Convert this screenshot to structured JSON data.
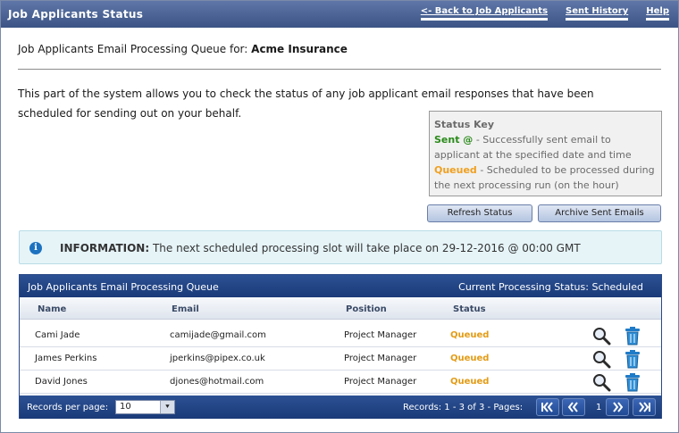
{
  "window": {
    "title": "Job Applicants Status",
    "links": [
      "<- Back to Job Applicants",
      "Sent History",
      "Help"
    ]
  },
  "header": {
    "prefix": "Job Applicants Email Processing Queue for:",
    "company": "Acme Insurance"
  },
  "description": "This part of the system allows you to check the status of any job applicant email responses that have been scheduled for sending out on your behalf.",
  "status_key": {
    "title": "Status Key",
    "sent_label": "Sent @",
    "sent_text": "- Successfully sent email to applicant at the specified date and time",
    "queued_label": "Queued",
    "queued_text": "- Scheduled to be processed during the next processing run (on the hour)"
  },
  "buttons": {
    "refresh": "Refresh Status",
    "archive": "Archive Sent Emails"
  },
  "info": {
    "label": "INFORMATION:",
    "text": "The next scheduled processing slot will take place on 29-12-2016 @ 00:00 GMT"
  },
  "grid": {
    "title": "Job Applicants Email Processing Queue",
    "processing_status": "Current Processing Status: Scheduled",
    "columns": [
      "Name",
      "Email",
      "Position",
      "Status"
    ],
    "rows": [
      {
        "name": "Cami Jade",
        "email": "camijade@gmail.com",
        "position": "Project Manager",
        "status": "Queued"
      },
      {
        "name": "James Perkins",
        "email": "jperkins@pipex.co.uk",
        "position": "Project Manager",
        "status": "Queued"
      },
      {
        "name": "David Jones",
        "email": "djones@hotmail.com",
        "position": "Project Manager",
        "status": "Queued"
      }
    ],
    "footer": {
      "records_per_page_label": "Records per page:",
      "records_per_page_value": "10",
      "records_text": "Records: 1 - 3 of 3 - Pages:",
      "current_page": "1"
    }
  },
  "colors": {
    "titlebar": "#4a6396",
    "grid_header": "#23468a",
    "sent": "#2a8a1a",
    "queued": "#e39b14",
    "info_bg": "#e6f4f8"
  },
  "icons": {
    "view": "magnifier-icon",
    "delete": "trash-icon",
    "info": "info-icon",
    "first": "first-page-icon",
    "prev": "prev-page-icon",
    "next": "next-page-icon",
    "last": "last-page-icon"
  }
}
